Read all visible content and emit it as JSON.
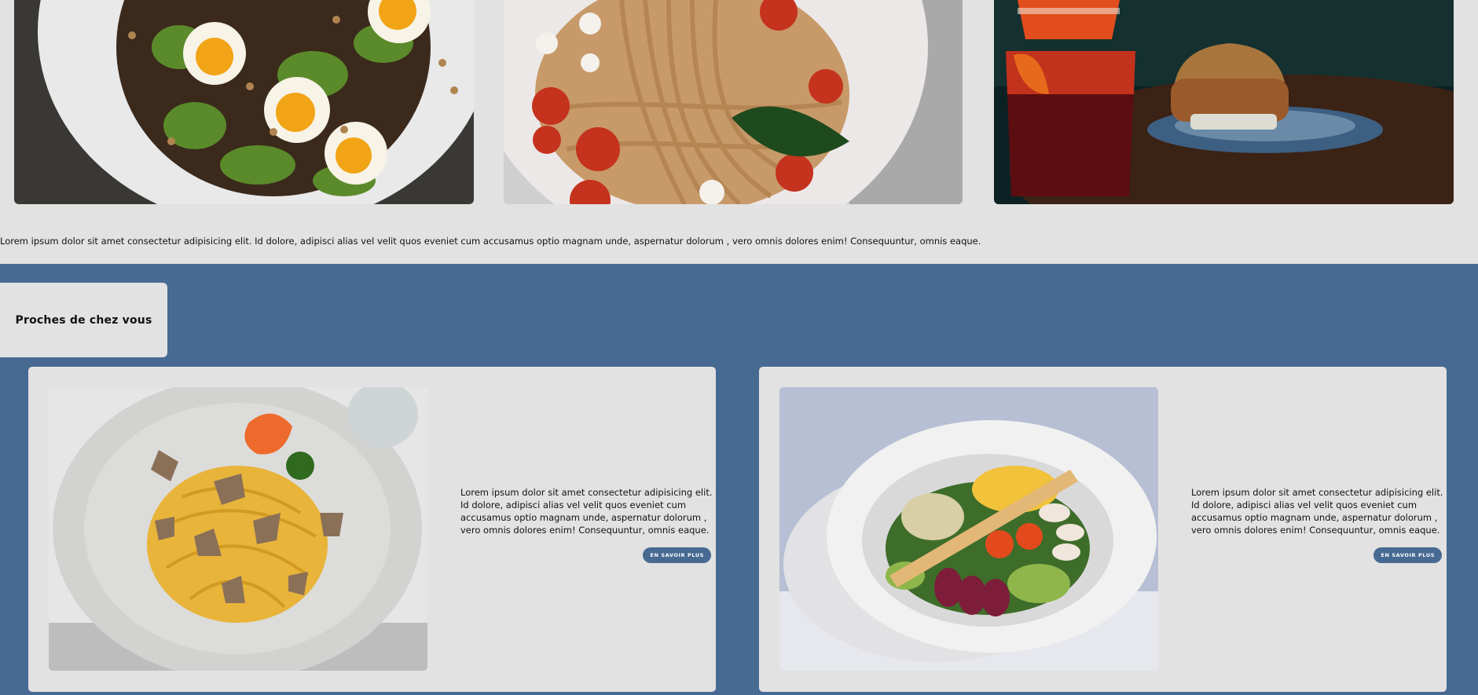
{
  "gallery": {
    "photos": [
      {
        "icon": "avocado-egg-toast-photo"
      },
      {
        "icon": "spaghetti-tomato-photo"
      },
      {
        "icon": "burger-cocktail-photo"
      }
    ]
  },
  "intro": {
    "text": "Lorem ipsum dolor sit amet consectetur adipisicing elit. Id dolore, adipisci alias vel velit quos eveniet cum accusamus optio magnam unde, aspernatur dolorum , vero omnis dolores enim! Consequuntur, omnis eaque."
  },
  "nearby": {
    "title": "Proches de chez vous",
    "cards": [
      {
        "icon": "truffle-pasta-photo",
        "text": "Lorem ipsum dolor sit amet consectetur adipisicing elit. Id dolore, adipisci alias vel velit quos eveniet cum accusamus optio magnam unde, aspernatur dolorum , vero omnis dolores enim! Consequuntur, omnis eaque.",
        "button": "EN SAVOIR PLUS"
      },
      {
        "icon": "salad-bowl-photo",
        "text": "Lorem ipsum dolor sit amet consectetur adipisicing elit. Id dolore, adipisci alias vel velit quos eveniet cum accusamus optio magnam unde, aspernatur dolorum , vero omnis dolores enim! Consequuntur, omnis eaque.",
        "button": "EN SAVOIR PLUS"
      }
    ]
  },
  "colors": {
    "page_background": "#e2e2e2",
    "section_blue": "#476a93",
    "button_text": "#ffffff"
  }
}
